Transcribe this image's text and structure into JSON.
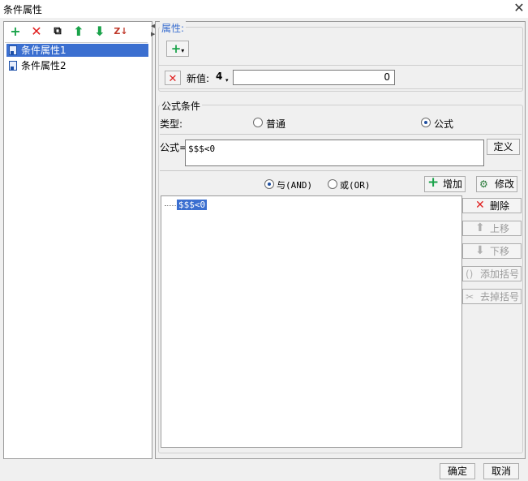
{
  "window": {
    "title": "条件属性",
    "close_icon": "close-icon"
  },
  "left_toolbar": {
    "icons": [
      "add-icon",
      "delete-icon",
      "copy-icon",
      "move-up-icon",
      "move-down-icon",
      "sort-icon"
    ]
  },
  "condition_list": {
    "items": [
      {
        "label": "条件属性1",
        "selected": true
      },
      {
        "label": "条件属性2",
        "selected": false
      }
    ]
  },
  "attributes": {
    "legend": "属性:",
    "add_icon": "add-icon",
    "new_value_label": "新值:",
    "new_value_type": "4",
    "new_value": "0"
  },
  "formula_condition": {
    "legend": "公式条件",
    "type_label": "类型:",
    "options": [
      {
        "label": "普通",
        "checked": false
      },
      {
        "label": "公式",
        "checked": true
      }
    ],
    "formula_label": "公式=",
    "formula_value": "$$$<0",
    "define_button": "定义",
    "and_label": "与(AND)",
    "or_label": "或(OR)",
    "and_checked": true,
    "add_button": "增加",
    "edit_button": "修改",
    "tree_item": "$$$<0",
    "side_buttons": [
      {
        "label": "删除",
        "enabled": true
      },
      {
        "label": "上移",
        "enabled": false
      },
      {
        "label": "下移",
        "enabled": false
      },
      {
        "label": "添加括号",
        "enabled": false
      },
      {
        "label": "去掉括号",
        "enabled": false
      }
    ]
  },
  "footer": {
    "ok_button": "确定",
    "cancel_button": "取消"
  }
}
